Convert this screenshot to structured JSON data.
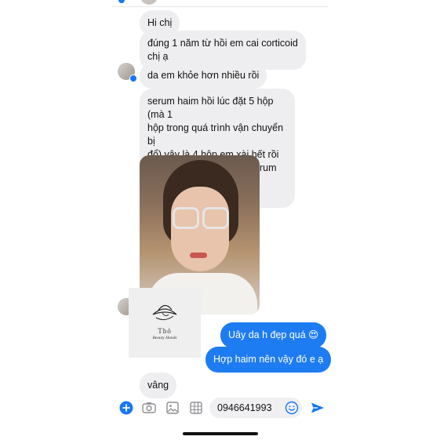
{
  "messages": {
    "m1": "Hi chị",
    "m2": "đúng 1 năm từ hồi em cai corticoid\nchị ạ",
    "m3": "da em khỏe hơn nhiều rồi",
    "m4": "serum haim hồi lúc đặt 5 hộp (mà 1\nhộp trong quá trình vận chuyển bị\nđổ) vậy là 4 hộp em xài hết rồi\ngiờ em chuyển qua xài serum night\nrepair của estee lauder ạ",
    "m5": "Uây da h đẹp quá 😍",
    "m6": "Hợp haim nên vậy đó e ạ",
    "m7": "vâng"
  },
  "shared_card": {
    "brand": "Thỏ",
    "tagline": "Beauty Hands"
  },
  "composer": {
    "input_value": "0946641993"
  },
  "colors": {
    "outgoing_bubble": "#1e7cf2",
    "incoming_bubble": "#eeeef0",
    "accent": "#1877f2"
  },
  "icons": [
    "plus-circle-icon",
    "camera-icon",
    "image-icon",
    "sticker-grid-icon",
    "emoji-icon",
    "send-icon",
    "messenger-badge-icon"
  ]
}
